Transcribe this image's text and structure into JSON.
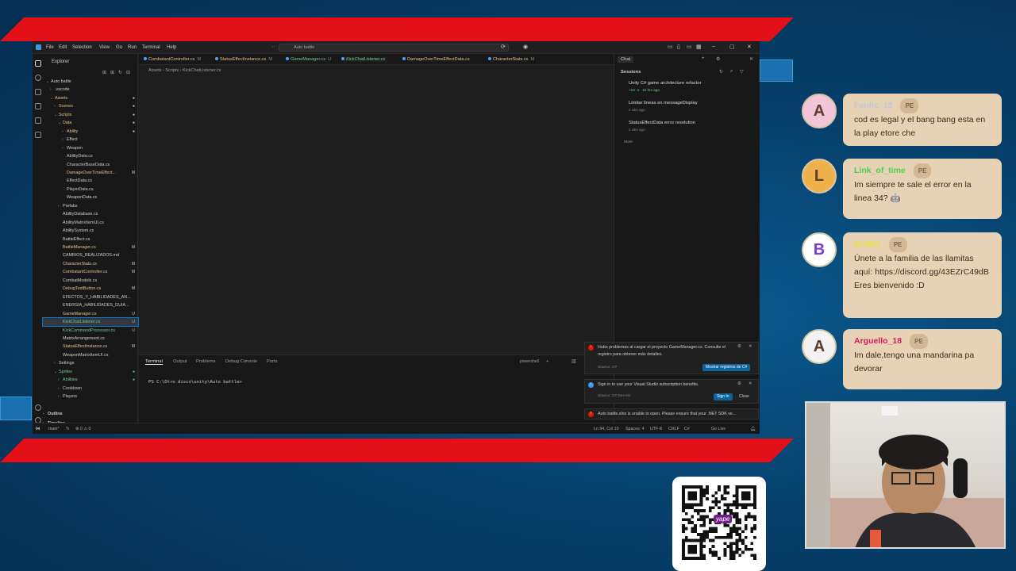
{
  "ide": {
    "menu": [
      "File",
      "Edit",
      "Selection",
      "View",
      "Go",
      "Run",
      "Terminal",
      "Help"
    ],
    "search": "Auto battle",
    "explorer_title": "Explorer",
    "tree": [
      {
        "label": "Auto battle",
        "indent": 0,
        "chev": "⌄",
        "color": "#cccccc",
        "badge": ""
      },
      {
        "label": ".vscode",
        "indent": 1,
        "chev": "›",
        "color": "#cccccc",
        "badge": ""
      },
      {
        "label": "Assets",
        "indent": 1,
        "chev": "⌄",
        "color": "#e2c08d",
        "badge": "●"
      },
      {
        "label": "Scenes",
        "indent": 2,
        "chev": "›",
        "color": "#e2c08d",
        "badge": "●"
      },
      {
        "label": "Scripts",
        "indent": 2,
        "chev": "⌄",
        "color": "#e2c08d",
        "badge": "●"
      },
      {
        "label": "Data",
        "indent": 3,
        "chev": "⌄",
        "color": "#e2c08d",
        "badge": "●"
      },
      {
        "label": "Ability",
        "indent": 4,
        "chev": "›",
        "color": "#e2c08d",
        "badge": "●"
      },
      {
        "label": "Effect",
        "indent": 4,
        "chev": "›",
        "color": "#cccccc",
        "badge": ""
      },
      {
        "label": "Weapon",
        "indent": 4,
        "chev": "›",
        "color": "#cccccc",
        "badge": ""
      },
      {
        "label": "AbilityData.cs",
        "indent": 4,
        "chev": "",
        "color": "#cccccc",
        "badge": ""
      },
      {
        "label": "CharacterBaseData.cs",
        "indent": 4,
        "chev": "",
        "color": "#cccccc",
        "badge": ""
      },
      {
        "label": "DamageOverTimeEffect...",
        "indent": 4,
        "chev": "",
        "color": "#e2c08d",
        "badge": "M"
      },
      {
        "label": "EffectData.cs",
        "indent": 4,
        "chev": "",
        "color": "#cccccc",
        "badge": ""
      },
      {
        "label": "PlayerData.cs",
        "indent": 4,
        "chev": "",
        "color": "#cccccc",
        "badge": ""
      },
      {
        "label": "WeaponData.cs",
        "indent": 4,
        "chev": "",
        "color": "#cccccc",
        "badge": ""
      },
      {
        "label": "Prefabs",
        "indent": 3,
        "chev": "›",
        "color": "#cccccc",
        "badge": ""
      },
      {
        "label": "AbilityDatabase.cs",
        "indent": 3,
        "chev": "",
        "color": "#cccccc",
        "badge": ""
      },
      {
        "label": "AbilityMatrixItemUI.cs",
        "indent": 3,
        "chev": "",
        "color": "#cccccc",
        "badge": ""
      },
      {
        "label": "AbilitySystem.cs",
        "indent": 3,
        "chev": "",
        "color": "#cccccc",
        "badge": ""
      },
      {
        "label": "BattleEffect.cs",
        "indent": 3,
        "chev": "",
        "color": "#cccccc",
        "badge": ""
      },
      {
        "label": "BattleManager.cs",
        "indent": 3,
        "chev": "",
        "color": "#e2c08d",
        "badge": "M"
      },
      {
        "label": "CAMBIOS_REALIZADOS.md",
        "indent": 3,
        "chev": "",
        "color": "#cccccc",
        "badge": ""
      },
      {
        "label": "CharacterStats.cs",
        "indent": 3,
        "chev": "",
        "color": "#e2c08d",
        "badge": "M"
      },
      {
        "label": "CombatantController.cs",
        "indent": 3,
        "chev": "",
        "color": "#e2c08d",
        "badge": "M"
      },
      {
        "label": "CombatModels.cs",
        "indent": 3,
        "chev": "",
        "color": "#cccccc",
        "badge": ""
      },
      {
        "label": "DebugTestButton.cs",
        "indent": 3,
        "chev": "",
        "color": "#e2c08d",
        "badge": "M"
      },
      {
        "label": "EFECTOS_Y_HABILIDADES_AN...",
        "indent": 3,
        "chev": "",
        "color": "#cccccc",
        "badge": ""
      },
      {
        "label": "ENERGIA_HABILIDADES_GUIA...",
        "indent": 3,
        "chev": "",
        "color": "#cccccc",
        "badge": ""
      },
      {
        "label": "GameManager.cs",
        "indent": 3,
        "chev": "",
        "color": "#e2c08d",
        "badge": "U"
      },
      {
        "label": "KickChatListener.cs",
        "indent": 3,
        "chev": "",
        "color": "#73c991",
        "badge": "U",
        "selected": true
      },
      {
        "label": "KickCommandProcessor.cs",
        "indent": 3,
        "chev": "",
        "color": "#73c991",
        "badge": "U"
      },
      {
        "label": "MatrixArrangement.cs",
        "indent": 3,
        "chev": "",
        "color": "#cccccc",
        "badge": ""
      },
      {
        "label": "StatusEffectInstance.cs",
        "indent": 3,
        "chev": "",
        "color": "#e2c08d",
        "badge": "M"
      },
      {
        "label": "WeaponMatrixItemUI.cs",
        "indent": 3,
        "chev": "",
        "color": "#cccccc",
        "badge": ""
      },
      {
        "label": "Settings",
        "indent": 2,
        "chev": "›",
        "color": "#cccccc",
        "badge": ""
      },
      {
        "label": "Sprites",
        "indent": 2,
        "chev": "⌄",
        "color": "#73c991",
        "badge": "●"
      },
      {
        "label": "Abilities",
        "indent": 3,
        "chev": "›",
        "color": "#73c991",
        "badge": "●"
      },
      {
        "label": "Cooldown",
        "indent": 3,
        "chev": "›",
        "color": "#cccccc",
        "badge": ""
      },
      {
        "label": "Players",
        "indent": 3,
        "chev": "›",
        "color": "#cccccc",
        "badge": ""
      }
    ],
    "outline": "Outline",
    "timeline": "Timeline",
    "tabs": [
      {
        "label": "CombatantController.cs",
        "badge": "M",
        "color": "#e2c08d"
      },
      {
        "label": "StatusEffectInstance.cs",
        "badge": "M",
        "color": "#e2c08d"
      },
      {
        "label": "GameManager.cs",
        "badge": "U",
        "color": "#73c991"
      },
      {
        "label": "KickChatListener.cs",
        "badge": "",
        "color": "#73c991",
        "active": true
      },
      {
        "label": "DamageOverTimeEffectData.cs",
        "badge": "",
        "color": "#e2c08d"
      },
      {
        "label": "CharacterStats.cs",
        "badge": "M",
        "color": "#e2c08d"
      }
    ],
    "breadcrumb": "Assets › Scripts › KickChatListener.cs",
    "panel_tabs": [
      "Terminal",
      "Output",
      "Problems",
      "Debug Console",
      "Ports"
    ],
    "shell": "powershell",
    "prompt": "PS C:\\Otro disco\\unity\\Auto battle>",
    "chat": {
      "header": "Chat",
      "sessions_label": "Sessions",
      "sessions": [
        {
          "title": "Unity C# game architecture refactor",
          "meta": "+23 -4 · 10 hrs ago"
        },
        {
          "title": "Limitar líneas en messageDisplay",
          "meta": "2 wks ago"
        },
        {
          "title": "StatusEffectData error resolution",
          "meta": "2 wks ago"
        }
      ],
      "more": "More"
    },
    "notifications": [
      {
        "text": "Hubo problemas al cargar el proyecto GameManager.cs. Consulte el registro para obtener más detalles.",
        "source": "Source: C#",
        "button": "Mostrar registros de C#"
      },
      {
        "text": "Sign in to use your Visual Studio subscription benefits.",
        "source": "Source: C# Dev Kit",
        "button": "Sign In",
        "button2": "Close"
      },
      {
        "text": "Auto battle.slnx is unable to open. Please ensure that your .NET SDK ve..."
      }
    ],
    "status": {
      "branch": "main*",
      "problems": "⊗ 0 ⚠ 0",
      "position": "Ln 94, Col 10",
      "spaces": "Spaces: 4",
      "encoding": "UTF-8",
      "eol": "CRLF",
      "lang": "C#",
      "golive": "Go Live"
    }
  },
  "stream_chat": [
    {
      "user": "Fanfic_18",
      "badge": "PE",
      "text": "cod es legal y el bang bang esta en la play etore che",
      "user_color": "#c0c8d8",
      "avatar": "A"
    },
    {
      "user": "Link_of_time",
      "badge": "PE",
      "text": "Im siempre te sale el error en la linea 34? 🤖",
      "user_color": "#4cd04c",
      "avatar": "L"
    },
    {
      "user": "BotRix",
      "badge": "PE",
      "text": "Únete a la familia de las llamitas aquí: https://discord.gg/43EZrC49dB Eres bienvenido :D",
      "user_color": "#e8e040",
      "avatar": "B"
    },
    {
      "user": "Arguello_18",
      "badge": "PE",
      "text": "Im dale,tengo una mandarina pa devorar",
      "user_color": "#d81b60",
      "avatar": "A"
    }
  ],
  "qr": {
    "brand": "yape"
  }
}
